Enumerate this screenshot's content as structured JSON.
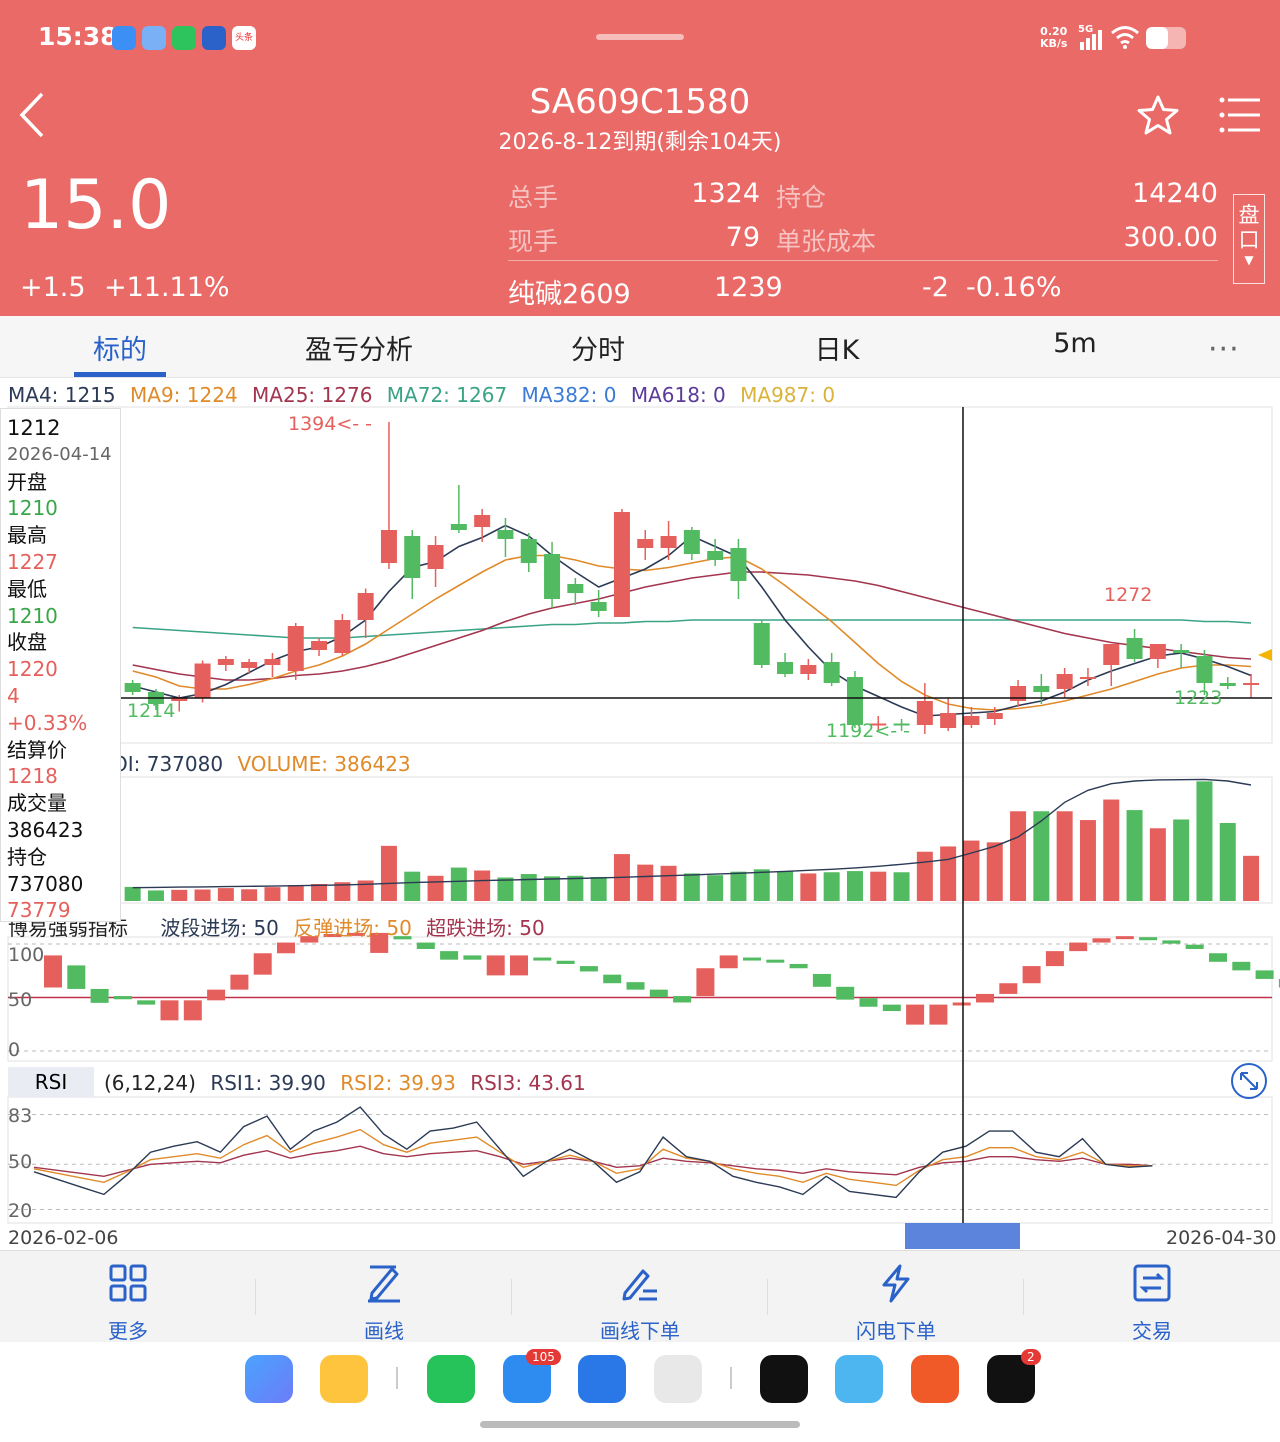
{
  "status": {
    "time": "15:38",
    "net_speed": "0.20",
    "net_unit": "KB/s",
    "signal": "5G",
    "toutiao": "头条"
  },
  "header": {
    "back_icon": "chevron-left-icon",
    "title": "SA609C1580",
    "subtitle": "2026-8-12到期(剩余104天)",
    "star_icon": "star-icon",
    "menu_icon": "menu-icon"
  },
  "quote": {
    "price": "15.0",
    "change": "+1.5",
    "change_pct": "+11.11%"
  },
  "stats": {
    "total_label": "总手",
    "total": "1324",
    "pos_label": "持仓",
    "pos": "14240",
    "cur_label": "现手",
    "cur": "79",
    "cost_label": "单张成本",
    "cost": "300.00",
    "under_name": "纯碱2609",
    "under_price": "1239",
    "under_chg": "-2",
    "under_pct": "-0.16%",
    "pankou": "盘口"
  },
  "tabs": [
    "标的",
    "盈亏分析",
    "分时",
    "日K",
    "5m"
  ],
  "more_icon": "more-dots-icon",
  "ma": {
    "ma4": "MA4: 1215",
    "ma9": "MA9: 1224",
    "ma25": "MA25: 1276",
    "ma72": "MA72: 1267",
    "ma382": "MA382: 0",
    "ma618": "MA618: 0",
    "ma987": "MA987: 0"
  },
  "main_labels": {
    "high": "1394<- -",
    "low": "1192<- -",
    "l1214": "1214",
    "l1272": "1272",
    "l1223": "1223"
  },
  "ohlc": {
    "price": "1212",
    "date": "2026-04-14",
    "open_l": "开盘",
    "open": "1210",
    "high_l": "最高",
    "high": "1227",
    "low_l": "最低",
    "low": "1210",
    "close_l": "收盘",
    "close": "1220",
    "chg": "4",
    "pct": "+0.33%",
    "settle_l": "结算价",
    "settle": "1218",
    "vol_l": "成交量",
    "vol": "386423",
    "oi_l": "持仓",
    "oi": "737080",
    "oi_chg": "73779"
  },
  "vol_hdr": {
    "oi": "OI: 737080",
    "vol": "VOLUME: 386423"
  },
  "ind_hdr": {
    "name": "博易强弱指标",
    "a": "波段进场: 50",
    "b": "反弹进场: 50",
    "c": "超跌进场: 50"
  },
  "ind_axis": [
    "100",
    "50",
    "0"
  ],
  "rsi_hdr": {
    "name": "RSI",
    "params": "(6,12,24)",
    "r1": "RSI1: 39.90",
    "r2": "RSI2: 39.93",
    "r3": "RSI3: 43.61"
  },
  "rsi_axis": [
    "83",
    "50",
    "20"
  ],
  "xaxis": {
    "start": "2026-02-06",
    "end": "2026-04-30"
  },
  "toolbar": [
    {
      "label": "更多",
      "icon": "grid-icon"
    },
    {
      "label": "画线",
      "icon": "draw-line-icon"
    },
    {
      "label": "画线下单",
      "icon": "draw-order-icon"
    },
    {
      "label": "闪电下单",
      "icon": "lightning-icon"
    },
    {
      "label": "交易",
      "icon": "trade-icon"
    }
  ],
  "dock": {
    "mail_badge": "105",
    "tiktok_badge": "2"
  },
  "colors": {
    "header": "#e96a67",
    "up": "#e5605c",
    "down": "#52bb61",
    "accent": "#2a62c9"
  },
  "chart_data": {
    "type": "candlestick",
    "candles": [
      [
        1220,
        1222,
        1212,
        1214
      ],
      [
        1214,
        1216,
        1202,
        1206
      ],
      [
        1208,
        1212,
        1201,
        1210
      ],
      [
        1210,
        1235,
        1207,
        1233
      ],
      [
        1232,
        1238,
        1228,
        1236
      ],
      [
        1230,
        1236,
        1226,
        1234
      ],
      [
        1232,
        1240,
        1224,
        1236
      ],
      [
        1228,
        1260,
        1222,
        1258
      ],
      [
        1242,
        1250,
        1238,
        1248
      ],
      [
        1240,
        1266,
        1238,
        1262
      ],
      [
        1262,
        1283,
        1250,
        1280
      ],
      [
        1300,
        1394,
        1296,
        1322
      ],
      [
        1318,
        1322,
        1276,
        1290
      ],
      [
        1296,
        1318,
        1284,
        1312
      ],
      [
        1326,
        1352,
        1320,
        1322
      ],
      [
        1324,
        1336,
        1314,
        1332
      ],
      [
        1322,
        1330,
        1304,
        1316
      ],
      [
        1316,
        1320,
        1294,
        1300
      ],
      [
        1306,
        1314,
        1270,
        1276
      ],
      [
        1286,
        1290,
        1272,
        1280
      ],
      [
        1274,
        1282,
        1264,
        1268
      ],
      [
        1264,
        1336,
        1264,
        1334
      ],
      [
        1310,
        1322,
        1302,
        1316
      ],
      [
        1310,
        1328,
        1302,
        1318
      ],
      [
        1322,
        1324,
        1302,
        1306
      ],
      [
        1308,
        1316,
        1298,
        1302
      ],
      [
        1310,
        1316,
        1276,
        1288
      ],
      [
        1260,
        1262,
        1230,
        1232
      ],
      [
        1234,
        1240,
        1224,
        1226
      ],
      [
        1226,
        1236,
        1222,
        1232
      ],
      [
        1234,
        1240,
        1218,
        1220
      ],
      [
        1224,
        1228,
        1190,
        1192
      ],
      [
        1193,
        1198,
        1188,
        1193
      ],
      [
        1193,
        1196,
        1188,
        1192
      ],
      [
        1192,
        1220,
        1186,
        1208
      ],
      [
        1190,
        1210,
        1188,
        1200
      ],
      [
        1192,
        1204,
        1190,
        1198
      ],
      [
        1196,
        1204,
        1192,
        1200
      ],
      [
        1208,
        1222,
        1204,
        1218
      ],
      [
        1218,
        1226,
        1206,
        1214
      ],
      [
        1216,
        1230,
        1210,
        1226
      ],
      [
        1224,
        1230,
        1218,
        1224
      ],
      [
        1232,
        1246,
        1218,
        1246
      ],
      [
        1250,
        1256,
        1234,
        1236
      ],
      [
        1236,
        1246,
        1230,
        1246
      ],
      [
        1242,
        1246,
        1230,
        1240
      ],
      [
        1238,
        1242,
        1212,
        1220
      ],
      [
        1220,
        1224,
        1216,
        1218
      ],
      [
        1220,
        1226,
        1210,
        1220
      ]
    ],
    "ma4": [
      1218,
      1214,
      1210,
      1213,
      1219,
      1227,
      1235,
      1241,
      1244,
      1251,
      1262,
      1281,
      1297,
      1301,
      1311,
      1317,
      1325,
      1318,
      1305,
      1294,
      1284,
      1290,
      1296,
      1305,
      1318,
      1311,
      1304,
      1284,
      1262,
      1244,
      1228,
      1218,
      1211,
      1204,
      1198,
      1199,
      1200,
      1201,
      1205,
      1208,
      1214,
      1222,
      1228,
      1233,
      1238,
      1240,
      1236,
      1231,
      1225
    ],
    "ma9": [
      1228,
      1224,
      1218,
      1216,
      1216,
      1219,
      1223,
      1228,
      1232,
      1238,
      1246,
      1256,
      1266,
      1276,
      1285,
      1294,
      1302,
      1305,
      1305,
      1302,
      1298,
      1296,
      1295,
      1297,
      1300,
      1303,
      1304,
      1296,
      1285,
      1273,
      1261,
      1247,
      1233,
      1221,
      1212,
      1206,
      1203,
      1202,
      1203,
      1205,
      1208,
      1212,
      1216,
      1221,
      1226,
      1230,
      1232,
      1232,
      1231
    ],
    "ma25": [
      1232,
      1229,
      1226,
      1224,
      1222,
      1222,
      1223,
      1225,
      1226,
      1228,
      1231,
      1235,
      1240,
      1245,
      1250,
      1255,
      1261,
      1266,
      1270,
      1273,
      1276,
      1280,
      1284,
      1287,
      1290,
      1292,
      1294,
      1294,
      1293,
      1292,
      1290,
      1288,
      1285,
      1281,
      1277,
      1273,
      1269,
      1265,
      1261,
      1257,
      1253,
      1250,
      1247,
      1245,
      1243,
      1241,
      1239,
      1237,
      1236
    ],
    "ma72": [
      1257,
      1256,
      1255,
      1254,
      1253,
      1252,
      1251,
      1250,
      1250,
      1250,
      1251,
      1252,
      1253,
      1254,
      1255,
      1256,
      1257,
      1258,
      1259,
      1259,
      1260,
      1260,
      1261,
      1261,
      1262,
      1262,
      1262,
      1262,
      1262,
      1262,
      1262,
      1262,
      1262,
      1262,
      1262,
      1262,
      1262,
      1262,
      1262,
      1262,
      1262,
      1262,
      1262,
      1262,
      1262,
      1262,
      1261,
      1261,
      1260
    ],
    "volume": [
      120000,
      90000,
      95000,
      98000,
      110000,
      100000,
      118000,
      135000,
      145000,
      160000,
      175000,
      470000,
      250000,
      215000,
      285000,
      260000,
      200000,
      230000,
      210000,
      215000,
      205000,
      400000,
      310000,
      300000,
      235000,
      220000,
      250000,
      270000,
      255000,
      235000,
      245000,
      255000,
      250000,
      245000,
      420000,
      465000,
      515000,
      500000,
      765000,
      765000,
      765000,
      690000,
      865000,
      775000,
      620000,
      695000,
      1020000,
      665000,
      385000
    ],
    "oi": [
      100000,
      102000,
      104000,
      106000,
      108000,
      110000,
      112000,
      115000,
      118000,
      121000,
      125000,
      132000,
      138000,
      143000,
      148000,
      153000,
      157000,
      161000,
      165000,
      169000,
      173000,
      178000,
      184000,
      190000,
      196000,
      202000,
      208000,
      215000,
      222000,
      230000,
      238000,
      248000,
      260000,
      275000,
      292000,
      312000,
      360000,
      410000,
      480000,
      600000,
      740000,
      830000,
      880000,
      900000,
      908000,
      910000,
      912000,
      900000,
      870000
    ],
    "indicator": [
      80,
      58,
      45,
      42,
      38,
      38,
      38,
      48,
      62,
      82,
      92,
      98,
      100,
      101,
      101,
      98,
      92,
      84,
      80,
      80,
      80,
      78,
      75,
      70,
      62,
      55,
      48,
      42,
      68,
      80,
      78,
      76,
      72,
      60,
      48,
      40,
      34,
      34,
      34,
      36,
      44,
      54,
      70,
      84,
      92,
      96,
      98,
      97,
      94,
      90,
      82,
      74,
      66,
      58,
      50
    ],
    "rsi1": [
      45,
      40,
      35,
      30,
      43,
      58,
      62,
      65,
      58,
      75,
      82,
      60,
      72,
      78,
      88,
      70,
      60,
      72,
      74,
      78,
      60,
      42,
      52,
      60,
      52,
      38,
      45,
      68,
      55,
      52,
      42,
      38,
      35,
      30,
      42,
      32,
      30,
      28,
      45,
      58,
      62,
      72,
      72,
      58,
      55,
      67,
      50,
      48,
      49
    ],
    "rsi2": [
      47,
      44,
      41,
      38,
      45,
      53,
      55,
      57,
      54,
      63,
      69,
      58,
      64,
      68,
      73,
      63,
      58,
      64,
      66,
      68,
      58,
      48,
      52,
      56,
      52,
      44,
      47,
      60,
      54,
      52,
      47,
      44,
      42,
      38,
      44,
      40,
      38,
      36,
      46,
      53,
      55,
      61,
      61,
      55,
      53,
      58,
      50,
      49,
      49
    ],
    "rsi3": [
      48,
      46,
      44,
      42,
      46,
      50,
      51,
      52,
      51,
      56,
      59,
      54,
      57,
      59,
      62,
      57,
      55,
      57,
      58,
      59,
      55,
      50,
      52,
      54,
      52,
      48,
      49,
      54,
      52,
      51,
      49,
      47,
      46,
      44,
      47,
      45,
      44,
      43,
      48,
      51,
      52,
      55,
      55,
      53,
      52,
      54,
      50,
      50,
      49
    ]
  }
}
